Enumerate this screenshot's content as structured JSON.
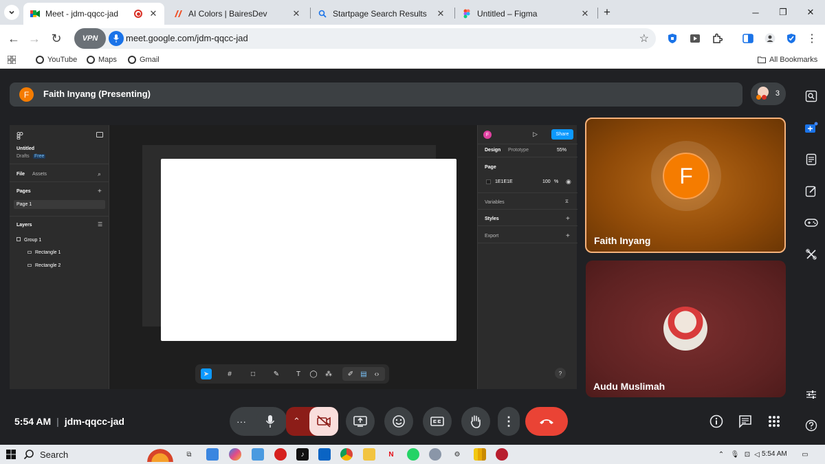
{
  "browser": {
    "tabs": [
      {
        "title": "Meet - jdm-qqcc-jad",
        "active": true,
        "recording": true
      },
      {
        "title": "AI Colors | BairesDev",
        "active": false
      },
      {
        "title": "Startpage Search Results",
        "active": false
      },
      {
        "title": "Untitled – Figma",
        "active": false
      }
    ],
    "new_tab": "+",
    "url": "meet.google.com/jdm-qqcc-jad",
    "vpn_label": "VPN",
    "bookmarks": [
      "YouTube",
      "Maps",
      "Gmail"
    ],
    "all_bookmarks": "All Bookmarks"
  },
  "meet": {
    "presenter_initial": "F",
    "presenter_label": "Faith Inyang (Presenting)",
    "participant_count": "3",
    "meeting_time": "5:54 AM",
    "meeting_code": "jdm-qqcc-jad",
    "participants": [
      {
        "name": "Faith Inyang",
        "initial": "F",
        "color": "#f57c00"
      },
      {
        "name": "Audu Muslimah"
      }
    ]
  },
  "figma": {
    "file_name": "Untitled",
    "drafts": "Drafts",
    "plan": "Free",
    "tabs": [
      "File",
      "Assets"
    ],
    "pages_header": "Pages",
    "page_name": "Page 1",
    "layers_header": "Layers",
    "layers": [
      "Group 1",
      "Rectangle 1",
      "Rectangle 2"
    ],
    "right_tabs": [
      "Design",
      "Prototype"
    ],
    "zoom": "55%",
    "share": "Share",
    "avatar_initial": "F",
    "page_section": "Page",
    "page_color": "1E1E1E",
    "page_opacity": "100",
    "percent": "%",
    "variables": "Variables",
    "styles": "Styles",
    "export": "Export",
    "help": "?"
  },
  "taskbar": {
    "search_label": "Search",
    "clock": "5:54 AM"
  },
  "colors": {
    "accent": "#1a73e8",
    "hangup": "#ea4335",
    "camera_off": "#f9dedc",
    "camera_off_btn": "#8c1d18",
    "tile_border": "#f6b27b"
  }
}
